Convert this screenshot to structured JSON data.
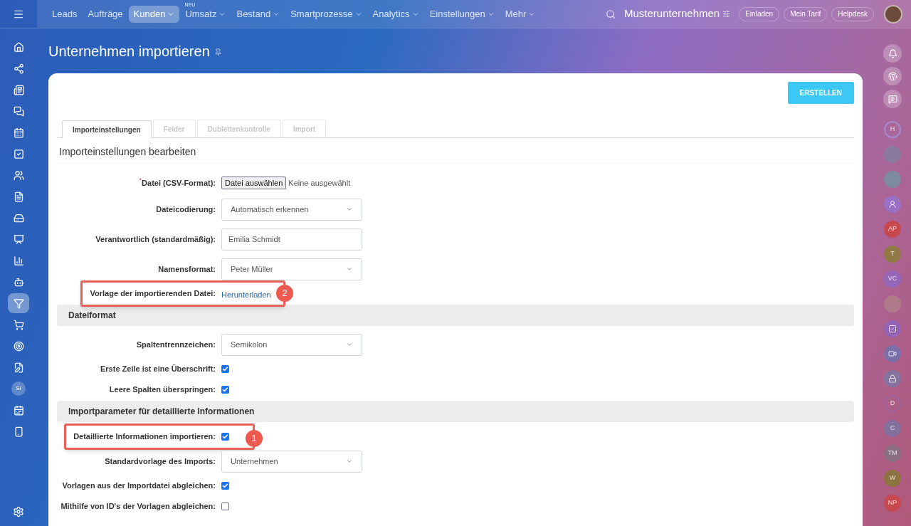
{
  "left_sidebar": {
    "items": [
      {
        "kind": "icon",
        "selected": false
      },
      {
        "kind": "icon",
        "selected": false
      },
      {
        "kind": "icon",
        "selected": false
      },
      {
        "kind": "icon",
        "selected": false
      },
      {
        "kind": "icon",
        "selected": false
      },
      {
        "kind": "icon",
        "selected": false
      },
      {
        "kind": "icon",
        "selected": false
      },
      {
        "kind": "icon",
        "selected": false
      },
      {
        "kind": "icon",
        "selected": false
      },
      {
        "kind": "icon",
        "selected": false
      },
      {
        "kind": "icon",
        "selected": false
      },
      {
        "kind": "icon",
        "selected": false
      },
      {
        "kind": "icon",
        "selected": true
      },
      {
        "kind": "icon",
        "selected": false
      },
      {
        "kind": "icon",
        "selected": false
      },
      {
        "kind": "icon",
        "selected": false
      },
      {
        "kind": "initials",
        "label": "SI",
        "selected": false
      },
      {
        "kind": "icon",
        "selected": false
      },
      {
        "kind": "icon",
        "selected": false
      }
    ]
  },
  "top_nav": {
    "items": [
      {
        "label": "Leads",
        "selected": false,
        "dropdown": false
      },
      {
        "label": "Aufträge",
        "selected": false,
        "dropdown": false
      },
      {
        "label": "Kunden",
        "selected": true,
        "dropdown": true
      },
      {
        "label": "Umsatz",
        "selected": false,
        "dropdown": true,
        "badge": "NEU"
      },
      {
        "label": "Bestand",
        "selected": false,
        "dropdown": true
      },
      {
        "label": "Smartprozesse",
        "selected": false,
        "dropdown": true
      },
      {
        "label": "Analytics",
        "selected": false,
        "dropdown": true
      },
      {
        "label": "Einstellungen",
        "selected": false,
        "dropdown": true
      },
      {
        "label": "Mehr",
        "selected": false,
        "dropdown": true
      }
    ],
    "company": "Musterunternehmen",
    "buttons": [
      "Einladen",
      "Mein Tarif",
      "Helpdesk"
    ]
  },
  "page": {
    "title": "Unternehmen importieren",
    "create_button": "ERSTELLEN",
    "tabs": [
      {
        "label": "Importeinstellungen",
        "selected": true
      },
      {
        "label": "Felder",
        "selected": false
      },
      {
        "label": "Dublettenkontrolle",
        "selected": false
      },
      {
        "label": "Import",
        "selected": false
      }
    ],
    "heading": "Importeinstellungen bearbeiten",
    "rows": [
      {
        "kind": "file",
        "label": "Datei (CSV-Format):",
        "required_mark": "*",
        "button": "Datei auswählen",
        "status": "Keine ausgewählt"
      },
      {
        "kind": "select",
        "label": "Dateicodierung:",
        "value": "Automatisch erkennen"
      },
      {
        "kind": "input",
        "label": "Verantwortlich (standardmäßig):",
        "value": "Emilia Schmidt"
      },
      {
        "kind": "select",
        "label": "Namensformat:",
        "value": "Peter Müller"
      },
      {
        "kind": "link",
        "label": "Vorlage der importierenden Datei:",
        "link": "Herunterladen",
        "callout": "2"
      },
      {
        "kind": "section",
        "label": "Dateiformat"
      },
      {
        "kind": "select",
        "label": "Spaltentrennzeichen:",
        "value": "Semikolon"
      },
      {
        "kind": "checkbox",
        "label": "Erste Zeile ist eine Überschrift:",
        "checked": true
      },
      {
        "kind": "checkbox",
        "label": "Leere Spalten überspringen:",
        "checked": true
      },
      {
        "kind": "section",
        "label": "Importparameter für detaillierte Informationen"
      },
      {
        "kind": "checkbox",
        "label": "Detaillierte Informationen importieren:",
        "checked": true,
        "callout": "1"
      },
      {
        "kind": "select",
        "label": "Standardvorlage des Imports:",
        "value": "Unternehmen"
      },
      {
        "kind": "checkbox",
        "label": "Vorlagen aus der Importdatei abgleichen:",
        "checked": true
      },
      {
        "kind": "checkbox",
        "label": "Mithilfe von ID's der Vorlagen abgleichen:",
        "checked": false
      }
    ]
  },
  "right_sidebar": {
    "items": [
      {
        "kind": "outline",
        "label": "H",
        "color": "#a98bd0"
      },
      {
        "kind": "photo",
        "color": "#8a7aa0"
      },
      {
        "kind": "photo",
        "color": "#7d8aa0"
      },
      {
        "kind": "group",
        "color": "#9a6fc4"
      },
      {
        "kind": "initials",
        "label": "AP",
        "color": "#c8484f"
      },
      {
        "kind": "initials",
        "label": "T",
        "color": "#8f7a45"
      },
      {
        "kind": "initials",
        "label": "VC",
        "color": "#9565b8"
      },
      {
        "kind": "photo",
        "color": "#b07a8a"
      },
      {
        "kind": "task",
        "color": "#9363b6"
      },
      {
        "kind": "video",
        "color": "#7b6fa8"
      },
      {
        "kind": "lock",
        "color": "#85739f"
      },
      {
        "kind": "outline",
        "label": "D",
        "color": "#a2629c"
      },
      {
        "kind": "initials",
        "label": "C",
        "color": "#83709c"
      },
      {
        "kind": "initials",
        "label": "TM",
        "color": "#8a6f80"
      },
      {
        "kind": "initials",
        "label": "W",
        "color": "#8c7240"
      },
      {
        "kind": "initials",
        "label": "NP",
        "color": "#c8484f"
      }
    ]
  }
}
